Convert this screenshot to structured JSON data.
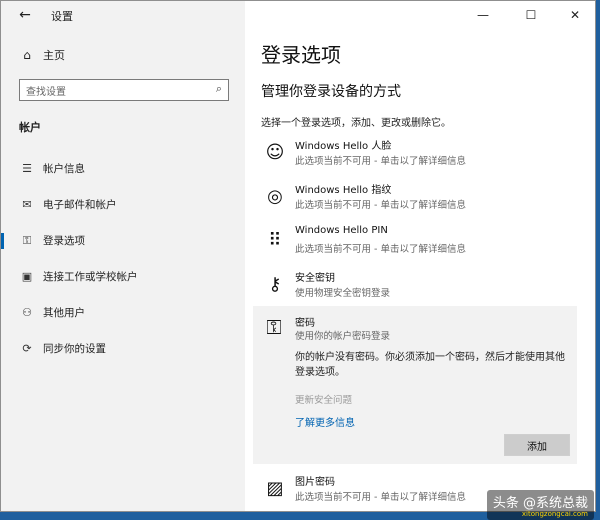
{
  "window": {
    "title": "设置",
    "back_icon": "←",
    "controls": {
      "minimize": "—",
      "maximize": "☐",
      "close": "✕"
    }
  },
  "sidebar": {
    "home": {
      "icon": "⌂",
      "label": "主页"
    },
    "search": {
      "placeholder": "查找设置",
      "icon": "⌕"
    },
    "section_title": "帐户",
    "items": [
      {
        "icon": "☰",
        "label": "帐户信息"
      },
      {
        "icon": "✉",
        "label": "电子邮件和帐户"
      },
      {
        "icon": "⚿",
        "label": "登录选项",
        "active": true
      },
      {
        "icon": "▣",
        "label": "连接工作或学校帐户"
      },
      {
        "icon": "⚇",
        "label": "其他用户"
      },
      {
        "icon": "⟳",
        "label": "同步你的设置"
      }
    ]
  },
  "main": {
    "page_title": "登录选项",
    "subheading": "管理你登录设备的方式",
    "instruction": "选择一个登录选项，添加、更改或删除它。",
    "options": [
      {
        "icon": "☺",
        "title": "Windows Hello 人脸",
        "desc": "此选项当前不可用 - 单击以了解详细信息"
      },
      {
        "icon": "◎",
        "title": "Windows Hello 指纹",
        "desc": "此选项当前不可用 - 单击以了解详细信息"
      },
      {
        "icon": "⠿",
        "title": "Windows Hello PIN",
        "desc": "此选项当前不可用 - 单击以了解详细信息"
      },
      {
        "icon": "⚷",
        "title": "安全密钥",
        "desc": "使用物理安全密钥登录"
      }
    ],
    "password": {
      "icon": "⚿",
      "title": "密码",
      "desc": "使用你的帐户密码登录",
      "message": "你的帐户没有密码。你必须添加一个密码，然后才能使用其他登录选项。",
      "update_link": "更新安全问题",
      "learn_more": "了解更多信息",
      "add_button": "添加"
    },
    "picture_password": {
      "icon": "▨",
      "title": "图片密码",
      "desc": "此选项当前不可用 - 单击以了解详细信息"
    }
  },
  "watermark": {
    "text": "头条 @系统总裁",
    "sub": "xitongzongcai.com"
  }
}
